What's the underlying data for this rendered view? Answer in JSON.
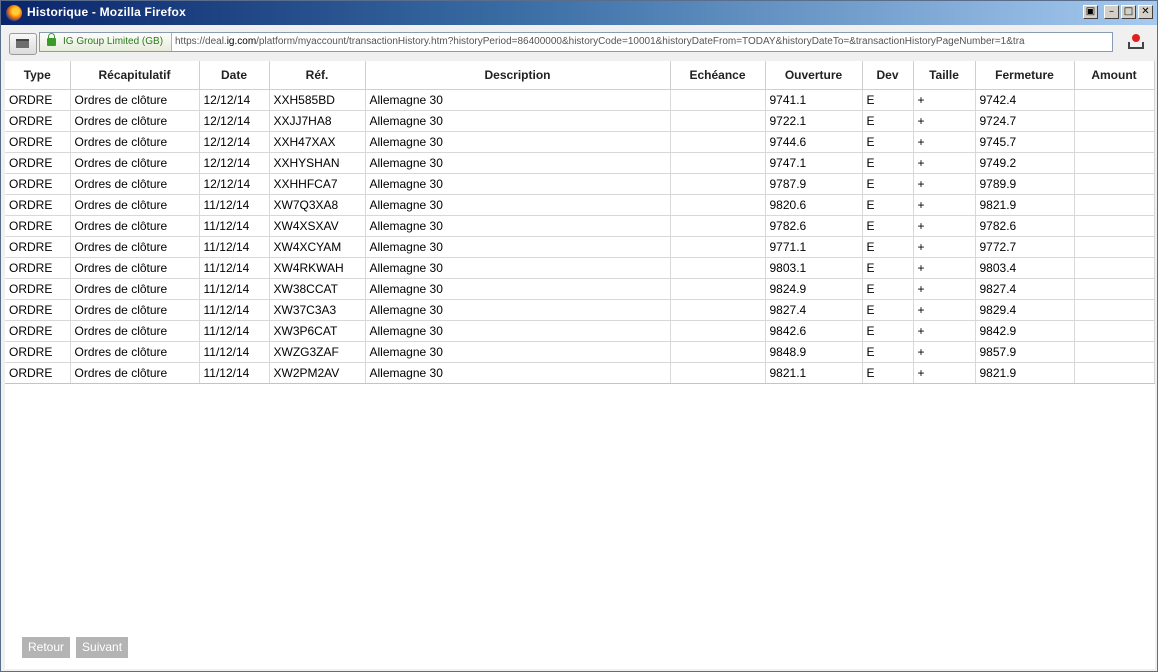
{
  "window": {
    "title": "Historique - Mozilla Firefox"
  },
  "navbar": {
    "identity": "IG Group Limited (GB)",
    "url_prefix": "https://deal.",
    "url_domain": "ig.com",
    "url_rest": "/platform/myaccount/transactionHistory.htm?historyPeriod=86400000&historyCode=10001&historyDateFrom=TODAY&historyDateTo=&transactionHistoryPageNumber=1&tra"
  },
  "table": {
    "headers": [
      "Type",
      "Récapitulatif",
      "Date",
      "Réf.",
      "Description",
      "Echéance",
      "Ouverture",
      "Dev",
      "Taille",
      "Fermeture",
      "Amount"
    ],
    "rows": [
      [
        "ORDRE",
        "Ordres de clôture",
        "12/12/14",
        "XXH585BD",
        "Allemagne 30",
        "",
        "9741.1",
        "E",
        "+",
        "9742.4",
        ""
      ],
      [
        "ORDRE",
        "Ordres de clôture",
        "12/12/14",
        "XXJJ7HA8",
        "Allemagne 30",
        "",
        "9722.1",
        "E",
        "+",
        "9724.7",
        ""
      ],
      [
        "ORDRE",
        "Ordres de clôture",
        "12/12/14",
        "XXH47XAX",
        "Allemagne 30",
        "",
        "9744.6",
        "E",
        "+",
        "9745.7",
        ""
      ],
      [
        "ORDRE",
        "Ordres de clôture",
        "12/12/14",
        "XXHYSHAN",
        "Allemagne 30",
        "",
        "9747.1",
        "E",
        "+",
        "9749.2",
        ""
      ],
      [
        "ORDRE",
        "Ordres de clôture",
        "12/12/14",
        "XXHHFCA7",
        "Allemagne 30",
        "",
        "9787.9",
        "E",
        "+",
        "9789.9",
        ""
      ],
      [
        "ORDRE",
        "Ordres de clôture",
        "11/12/14",
        "XW7Q3XA8",
        "Allemagne 30",
        "",
        "9820.6",
        "E",
        "+",
        "9821.9",
        ""
      ],
      [
        "ORDRE",
        "Ordres de clôture",
        "11/12/14",
        "XW4XSXAV",
        "Allemagne 30",
        "",
        "9782.6",
        "E",
        "+",
        "9782.6",
        ""
      ],
      [
        "ORDRE",
        "Ordres de clôture",
        "11/12/14",
        "XW4XCYAM",
        "Allemagne 30",
        "",
        "9771.1",
        "E",
        "+",
        "9772.7",
        ""
      ],
      [
        "ORDRE",
        "Ordres de clôture",
        "11/12/14",
        "XW4RKWAH",
        "Allemagne 30",
        "",
        "9803.1",
        "E",
        "+",
        "9803.4",
        ""
      ],
      [
        "ORDRE",
        "Ordres de clôture",
        "11/12/14",
        "XW38CCAT",
        "Allemagne 30",
        "",
        "9824.9",
        "E",
        "+",
        "9827.4",
        ""
      ],
      [
        "ORDRE",
        "Ordres de clôture",
        "11/12/14",
        "XW37C3A3",
        "Allemagne 30",
        "",
        "9827.4",
        "E",
        "+",
        "9829.4",
        ""
      ],
      [
        "ORDRE",
        "Ordres de clôture",
        "11/12/14",
        "XW3P6CAT",
        "Allemagne 30",
        "",
        "9842.6",
        "E",
        "+",
        "9842.9",
        ""
      ],
      [
        "ORDRE",
        "Ordres de clôture",
        "11/12/14",
        "XWZG3ZAF",
        "Allemagne 30",
        "",
        "9848.9",
        "E",
        "+",
        "9857.9",
        ""
      ],
      [
        "ORDRE",
        "Ordres de clôture",
        "11/12/14",
        "XW2PM2AV",
        "Allemagne 30",
        "",
        "9821.1",
        "E",
        "+",
        "9821.9",
        ""
      ]
    ]
  },
  "pagination": {
    "prev_label": "Retour",
    "next_label": "Suivant"
  }
}
